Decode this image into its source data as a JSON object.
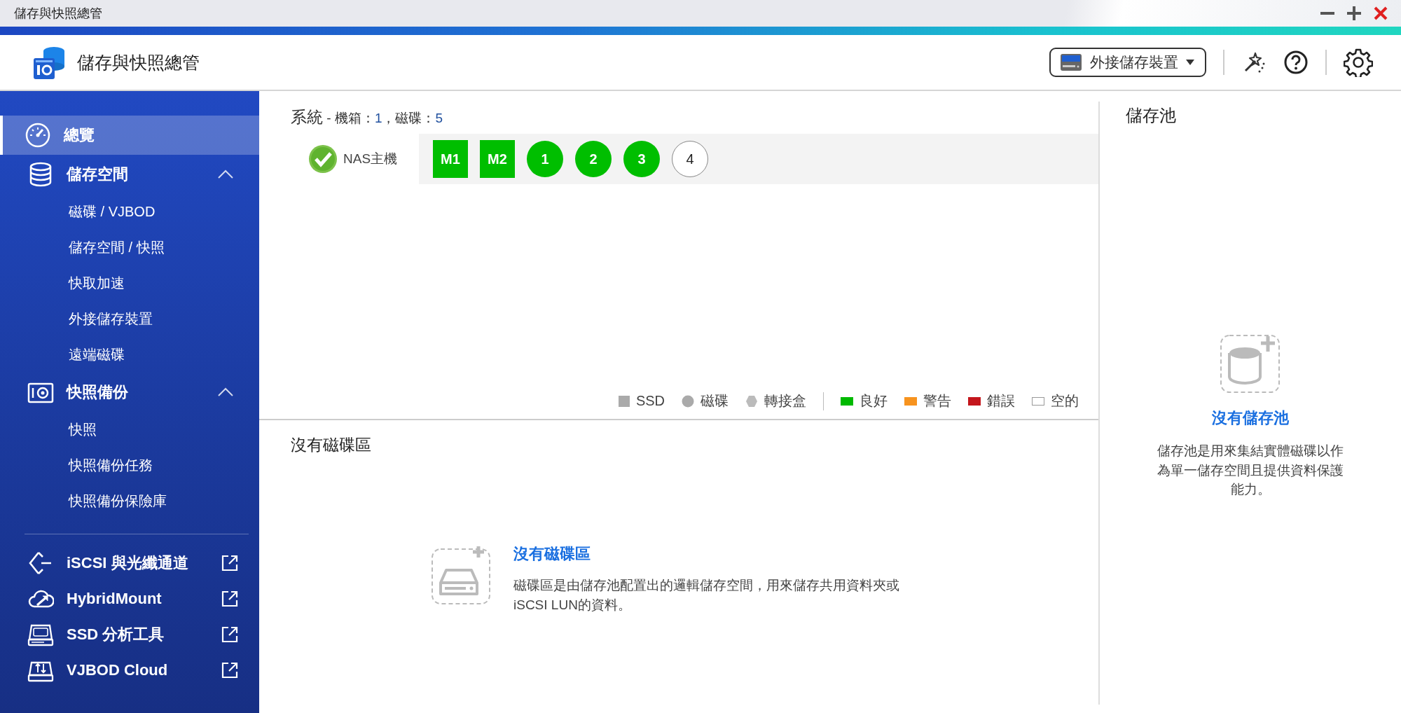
{
  "window": {
    "title": "儲存與快照總管"
  },
  "header": {
    "app_title": "儲存與快照總管",
    "device_menu": {
      "label": "外接儲存裝置"
    }
  },
  "sidebar": {
    "items": [
      {
        "label": "總覽",
        "selected": true
      },
      {
        "label": "儲存空間",
        "selected": false,
        "expanded": true,
        "children": [
          {
            "label": "磁碟 / VJBOD",
            "selected": false
          },
          {
            "label": "儲存空間 / 快照",
            "selected": false
          },
          {
            "label": "快取加速",
            "selected": false
          },
          {
            "label": "外接儲存裝置",
            "selected": false
          },
          {
            "label": "遠端磁碟",
            "selected": false
          }
        ]
      },
      {
        "label": "快照備份",
        "selected": false,
        "expanded": true,
        "children": [
          {
            "label": "快照",
            "selected": false
          },
          {
            "label": "快照備份任務",
            "selected": false
          },
          {
            "label": "快照備份保險庫",
            "selected": false
          }
        ]
      }
    ],
    "external_tools": [
      {
        "label": "iSCSI 與光纖通道"
      },
      {
        "label": "HybridMount"
      },
      {
        "label": "SSD 分析工具"
      },
      {
        "label": "VJBOD Cloud"
      }
    ]
  },
  "system": {
    "title": "系統",
    "summary": [
      {
        "kind": "label",
        "text": " - 機箱："
      },
      {
        "kind": "value",
        "text": "1"
      },
      {
        "kind": "label",
        "text": "，磁碟："
      },
      {
        "kind": "value",
        "text": "5"
      }
    ],
    "host": {
      "label": "NAS主機",
      "healthy": true
    },
    "disks": [
      {
        "label": "M1",
        "kind": "ssd",
        "color": "#00be00"
      },
      {
        "label": "M2",
        "kind": "ssd",
        "color": "#00be00"
      },
      {
        "label": "1",
        "kind": "hdd",
        "color": "#00be00"
      },
      {
        "label": "2",
        "kind": "hdd",
        "color": "#00be00"
      },
      {
        "label": "3",
        "kind": "hdd",
        "color": "#00be00"
      },
      {
        "label": "4",
        "kind": "hdd",
        "color": "#ffffff"
      }
    ],
    "legend": [
      {
        "kind": "ssd",
        "label": "SSD"
      },
      {
        "kind": "hdd",
        "label": "磁碟"
      },
      {
        "kind": "enclosure",
        "label": "轉接盒"
      },
      {
        "kind": "status",
        "label": "良好",
        "color": "#00b900"
      },
      {
        "kind": "status",
        "label": "警告",
        "color": "#f7931e"
      },
      {
        "kind": "status",
        "label": "錯誤",
        "color": "#c4161c"
      },
      {
        "kind": "status",
        "label": "空的",
        "color": "#ffffff"
      }
    ]
  },
  "volumes": {
    "title": "沒有磁碟區",
    "empty_title": "沒有磁碟區",
    "empty_text": "磁碟區是由儲存池配置出的邏輯儲存空間，用來儲存共用資料夾或 iSCSI LUN的資料。"
  },
  "storage_pools": {
    "title": "儲存池",
    "empty_title": "沒有儲存池",
    "empty_text": "儲存池是用來集結實體磁碟以作為單一儲存空間且提供資料保護能力。"
  }
}
